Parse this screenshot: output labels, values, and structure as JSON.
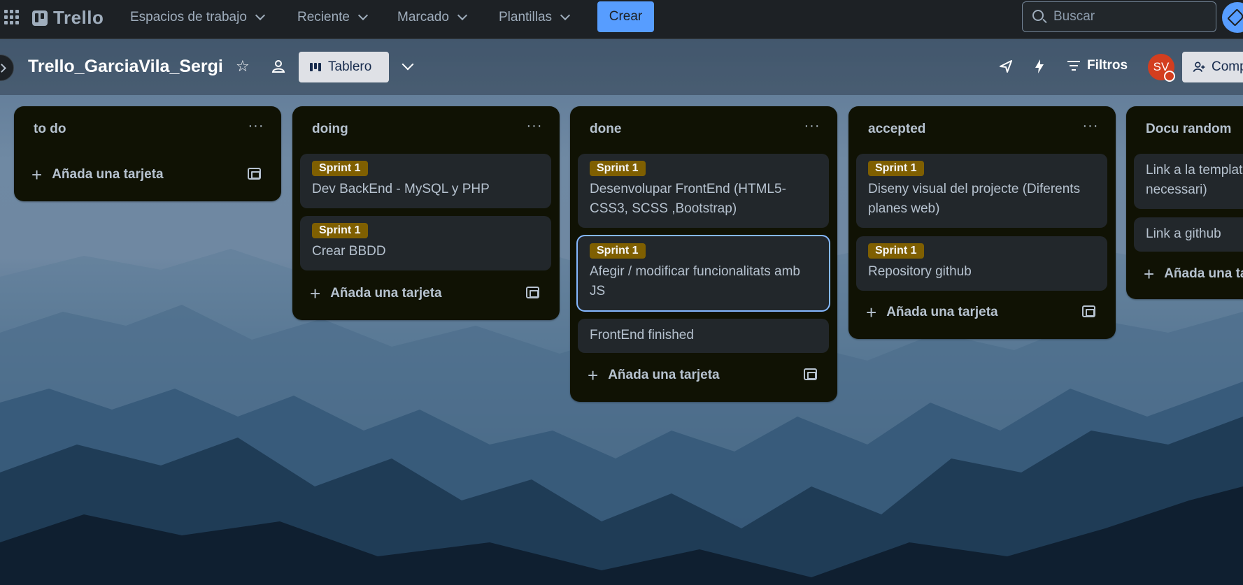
{
  "topnav": {
    "logo": "Trello",
    "menus": [
      {
        "label": "Espacios de trabajo"
      },
      {
        "label": "Reciente"
      },
      {
        "label": "Marcado"
      },
      {
        "label": "Plantillas"
      }
    ],
    "create_label": "Crear",
    "search_placeholder": "Buscar"
  },
  "board": {
    "title": "Trello_GarciaVila_Sergi",
    "view_label": "Tablero",
    "filters_label": "Filtros",
    "avatar_initials": "SV",
    "share_label": "Comp"
  },
  "lists": [
    {
      "title": "to do",
      "menu": "···",
      "cards": [],
      "add_label": "Añada una tarjeta"
    },
    {
      "title": "doing",
      "menu": "···",
      "cards": [
        {
          "label": "Sprint 1",
          "title_lines": [
            "Dev BackEnd - MySQL y PHP"
          ]
        },
        {
          "label": "Sprint 1",
          "title_lines": [
            "Crear BBDD"
          ]
        }
      ],
      "add_label": "Añada una tarjeta"
    },
    {
      "title": "done",
      "menu": "···",
      "cards": [
        {
          "label": "Sprint 1",
          "title_lines": [
            "Desenvolupar FrontEnd (HTML5-",
            "CSS3, SCSS ,Bootstrap)"
          ]
        },
        {
          "label": "Sprint 1",
          "title_lines": [
            "Afegir / modificar funcionalitats amb",
            "JS"
          ]
        },
        {
          "label": "",
          "title_lines": [
            "FrontEnd finished"
          ]
        }
      ],
      "add_label": "Añada una tarjeta"
    },
    {
      "title": "accepted",
      "menu": "···",
      "cards": [
        {
          "label": "Sprint 1",
          "title_lines": [
            "Diseny visual del projecte (Diferents",
            "planes web)"
          ]
        },
        {
          "label": "Sprint 1",
          "title_lines": [
            "Repository github"
          ]
        }
      ],
      "add_label": "Añada una tarjeta"
    },
    {
      "title": "Docu random",
      "menu": "",
      "cards": [
        {
          "label": "",
          "title_lines": [
            "Link a la templat",
            "necessari)"
          ]
        },
        {
          "label": "",
          "title_lines": [
            "Link a github"
          ]
        }
      ],
      "add_label": "Añada una ta"
    }
  ],
  "colors": {
    "nav_bg": "#1d2125",
    "list_bg": "#101204",
    "card_bg": "#22272b",
    "label_sprint": "#7f5f01",
    "accent": "#579dff",
    "avatar": "#d33e1f"
  }
}
